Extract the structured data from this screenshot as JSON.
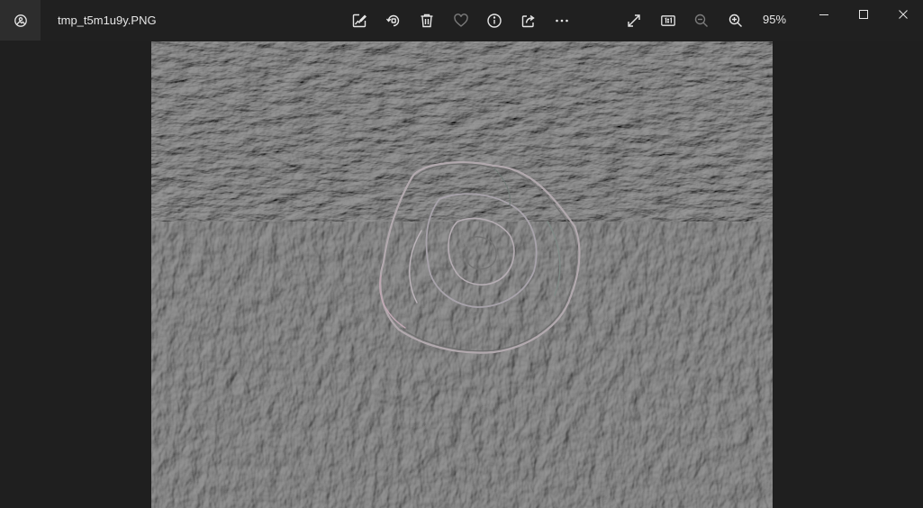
{
  "window": {
    "file_name": "tmp_t5m1u9y.PNG",
    "zoom_level": "95%"
  },
  "toolbar": {
    "app_icon": "photos-app-icon",
    "tools": [
      {
        "icon": "edit-image-icon",
        "label": "Edit image"
      },
      {
        "icon": "rotate-icon",
        "label": "Rotate"
      },
      {
        "icon": "delete-icon",
        "label": "Delete"
      },
      {
        "icon": "heart-icon",
        "label": "Favorite"
      },
      {
        "icon": "info-icon",
        "label": "File info"
      },
      {
        "icon": "share-icon",
        "label": "Share"
      },
      {
        "icon": "more-icon",
        "label": "See more"
      },
      {
        "icon": "full-screen-icon",
        "label": "Full screen"
      },
      {
        "icon": "actual-size-icon",
        "label": "Actual size"
      },
      {
        "icon": "zoom-out-icon",
        "label": "Zoom out"
      },
      {
        "icon": "zoom-in-icon",
        "label": "Zoom in"
      }
    ]
  },
  "caption_buttons": [
    "minimize-icon",
    "maximize-icon",
    "close-icon"
  ],
  "colors": {
    "titlebar": "#202020",
    "background": "#1f1f1f",
    "icon": "#e6e6e6",
    "disabled_icon": "#7a7a7a",
    "photo_gray": "#8a8a8a"
  }
}
